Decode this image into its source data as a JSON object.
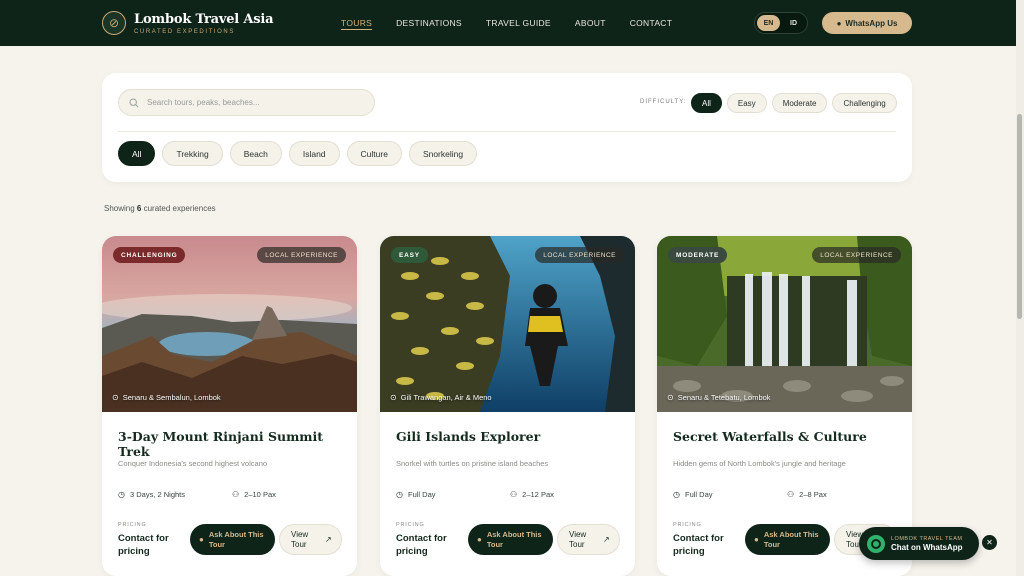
{
  "header": {
    "brand_name": "Lombok Travel Asia",
    "brand_tagline": "CURATED EXPEDITIONS",
    "brand_icon": "compass-icon",
    "nav": [
      {
        "label": "TOURS",
        "active": true
      },
      {
        "label": "DESTINATIONS",
        "active": false
      },
      {
        "label": "TRAVEL GUIDE",
        "active": false
      },
      {
        "label": "ABOUT",
        "active": false
      },
      {
        "label": "CONTACT",
        "active": false
      }
    ],
    "languages": [
      {
        "label": "EN",
        "active": true
      },
      {
        "label": "ID",
        "active": false
      }
    ],
    "whatsapp_label": "WhatsApp Us"
  },
  "filters": {
    "search_placeholder": "Search tours, peaks, beaches...",
    "difficulty_label": "DIFFICULTY:",
    "difficulty_options": [
      {
        "label": "All",
        "active": true
      },
      {
        "label": "Easy",
        "active": false
      },
      {
        "label": "Moderate",
        "active": false
      },
      {
        "label": "Challenging",
        "active": false
      }
    ],
    "categories": [
      {
        "label": "All",
        "active": true
      },
      {
        "label": "Trekking",
        "active": false
      },
      {
        "label": "Beach",
        "active": false
      },
      {
        "label": "Island",
        "active": false
      },
      {
        "label": "Culture",
        "active": false
      },
      {
        "label": "Snorkeling",
        "active": false
      }
    ]
  },
  "results": {
    "prefix": "Showing",
    "count": "6",
    "suffix": "curated experiences"
  },
  "tours": [
    {
      "difficulty": "CHALLENGING",
      "difficulty_color": "#7a2a2a",
      "local_tag": "LOCAL EXPERIENCE",
      "location": "Senaru & Sembalun, Lombok",
      "title": "3-Day Mount Rinjani Summit Trek",
      "description": "Conquer Indonesia's second highest volcano",
      "duration": "3 Days, 2 Nights",
      "group": "2–10 Pax",
      "pricing_label": "PRICING",
      "pricing_value": "Contact for pricing",
      "ask_label": "Ask About This Tour",
      "view_label": "View Tour"
    },
    {
      "difficulty": "EASY",
      "difficulty_color": "#2f5a3a",
      "local_tag": "LOCAL EXPERIENCE",
      "location": "Gili Trawangan, Air & Meno",
      "title": "Gili Islands Explorer",
      "description": "Snorkel with turtles on pristine island beaches",
      "duration": "Full Day",
      "group": "2–12 Pax",
      "pricing_label": "PRICING",
      "pricing_value": "Contact for pricing",
      "ask_label": "Ask About This Tour",
      "view_label": "View Tour"
    },
    {
      "difficulty": "MODERATE",
      "difficulty_color": "#3a4a3e",
      "local_tag": "LOCAL EXPERIENCE",
      "location": "Senaru & Tetebatu, Lombok",
      "title": "Secret Waterfalls & Culture",
      "description": "Hidden gems of North Lombok's jungle and heritage",
      "duration": "Full Day",
      "group": "2–8 Pax",
      "pricing_label": "PRICING",
      "pricing_value": "Contact for pricing",
      "ask_label": "Ask About This Tour",
      "view_label": "View Tour"
    }
  ],
  "whatsapp_float": {
    "sub": "LOMBOK TRAVEL TEAM",
    "main": "Chat on WhatsApp"
  }
}
